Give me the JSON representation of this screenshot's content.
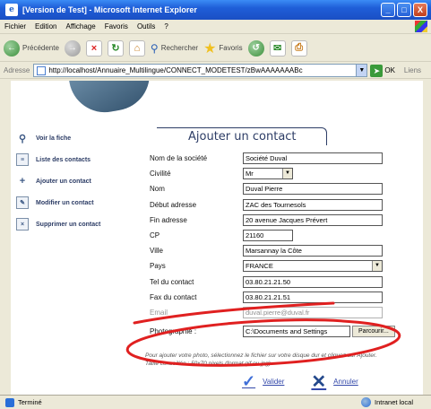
{
  "window": {
    "title": "[Version de Test] - Microsoft Internet Explorer",
    "buttons": {
      "minimize": "_",
      "maximize": "□",
      "close": "X"
    }
  },
  "menu": [
    "Fichier",
    "Edition",
    "Affichage",
    "Favoris",
    "Outils",
    "?"
  ],
  "toolbar": {
    "back_label": "Précédente",
    "search_label": "Rechercher",
    "favorites_label": "Favoris"
  },
  "address": {
    "label": "Adresse",
    "url": "http://localhost/Annuaire_Multilingue/CONNECT_MODETEST/zBwAAAAAAABc",
    "go_label": "OK",
    "links_label": "Liens"
  },
  "sidebar": {
    "items": [
      {
        "label": "Voir la fiche",
        "icon": "magnifier-icon"
      },
      {
        "label": "Liste des contacts",
        "icon": "list-icon"
      },
      {
        "label": "Ajouter un contact",
        "icon": "add-icon"
      },
      {
        "label": "Modifier un contact",
        "icon": "edit-icon"
      },
      {
        "label": "Supprimer un contact",
        "icon": "delete-icon"
      }
    ]
  },
  "form": {
    "title": "Ajouter un contact",
    "fields": [
      {
        "label": "Nom de la société",
        "value": "Société Duval"
      },
      {
        "label": "Civilité",
        "value": "Mr"
      },
      {
        "label": "Nom",
        "value": "Duval Pierre"
      },
      {
        "label": "Début adresse",
        "value": "ZAC des Tournesols"
      },
      {
        "label": "Fin adresse",
        "value": "20 avenue Jacques Prévert"
      },
      {
        "label": "CP",
        "value": "21160"
      },
      {
        "label": "Ville",
        "value": "Marsannay la Côte"
      },
      {
        "label": "Pays",
        "value": "FRANCE"
      },
      {
        "label": "Tel du contact",
        "value": "03.80.21.21.50"
      },
      {
        "label": "Fax du contact",
        "value": "03.80.21.21.51"
      },
      {
        "label": "Email",
        "value": "duval.pierre@duval.fr"
      }
    ],
    "photo": {
      "label": "Photographie :",
      "value": "C:\\Documents and Settings",
      "browse_label": "Parcourir..."
    },
    "hint_line1": "Pour ajouter votre photo, sélectionnez le fichier sur votre disque dur et cliquez sur Ajouter.",
    "hint_line2": "Taille conseillée : 50x70 pixels (format gif ou jpg)",
    "validate_label": "Valider",
    "cancel_label": "Annuler"
  },
  "status": {
    "text": "Terminé",
    "zone": "Intranet local"
  },
  "colors": {
    "annotation": "#e02020",
    "link": "#3348aa",
    "titlebar": "#1f5ed8"
  }
}
